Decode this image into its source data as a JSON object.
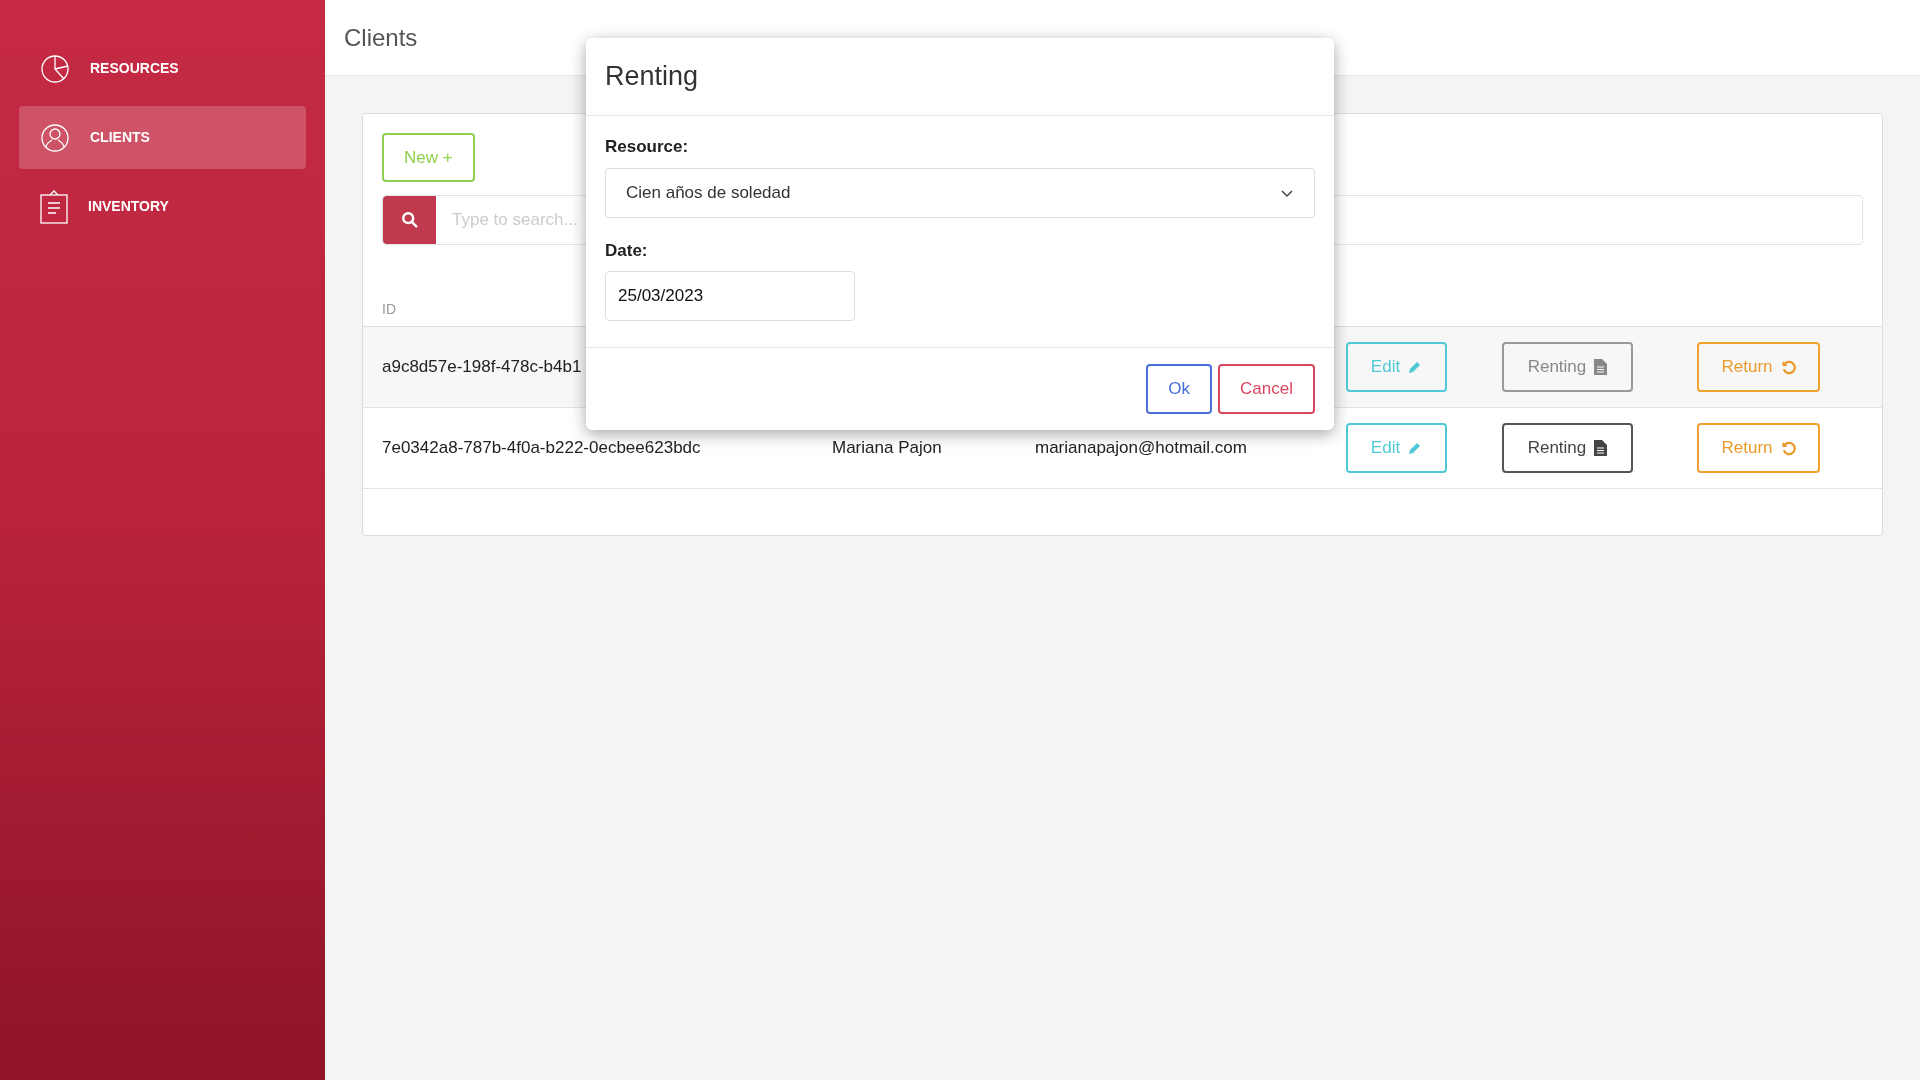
{
  "sidebar": {
    "items": [
      {
        "label": "RESOURCES",
        "selected": false
      },
      {
        "label": "CLIENTS",
        "selected": true
      },
      {
        "label": "INVENTORY",
        "selected": false
      }
    ]
  },
  "page": {
    "title": "Clients"
  },
  "toolbar": {
    "new_button": "New +",
    "search": {
      "placeholder": "Type to search..."
    }
  },
  "table": {
    "columns": [
      "ID"
    ],
    "rows": [
      {
        "id": "a9c8d57e-198f-478c-b4b1",
        "edit": "Edit",
        "renting": "Renting",
        "renting_disabled": true,
        "return": "Return"
      },
      {
        "id": "7e0342a8-787b-4f0a-b222-0ecbee623bdc",
        "name": "Mariana Pajon",
        "email": "marianapajon@hotmail.com",
        "edit": "Edit",
        "renting": "Renting",
        "renting_disabled": false,
        "return": "Return"
      }
    ]
  },
  "modal": {
    "title": "Renting",
    "resource_label": "Resource:",
    "resource_value": "Cien años de soledad",
    "date_label": "Date:",
    "date_value": "25/03/2023",
    "ok": "Ok",
    "cancel": "Cancel"
  }
}
